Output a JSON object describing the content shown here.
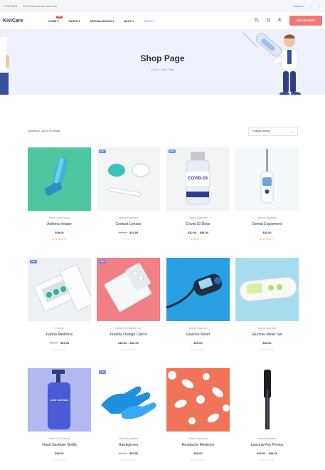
{
  "topbar": {
    "phone": "+1 234 5678",
    "address": "1234 North avenue Lake Lane",
    "follow_label": "Follow us :",
    "social_icons": [
      "facebook-icon",
      "twitter-icon"
    ]
  },
  "navbar": {
    "logo": "KiviCare",
    "items": [
      {
        "label": "HOME",
        "badge": "HOT",
        "active": false
      },
      {
        "label": "PAGES",
        "active": false
      },
      {
        "label": "SPECIALIZATION",
        "active": false
      },
      {
        "label": "BLOG",
        "active": false
      },
      {
        "label": "SHOP",
        "active": true
      }
    ],
    "icons": [
      "search-icon",
      "cart-icon",
      "user-icon"
    ],
    "appointment_label": "APPOINTMENT"
  },
  "hero": {
    "title": "Shop Page",
    "breadcrumb_home": "Home",
    "breadcrumb_sep": "»",
    "breadcrumb_current": "Shop Page"
  },
  "shop": {
    "results_text": "Showing 1–16 of 16 results",
    "sort_label": "Default sorting",
    "products": [
      {
        "category": "Health Care/Physical",
        "name": "Asthma Inhaler",
        "old_price": "",
        "price": "$45.00",
        "rating": 5,
        "sale": false
      },
      {
        "category": "Medical Equipment",
        "name": "Contact Lenses",
        "old_price": "$22.00",
        "price": "$19.00",
        "rating": 0,
        "sale": true
      },
      {
        "category": "Medical Equipment",
        "name": "Covid-19 Dose",
        "old_price": "",
        "price": "$32.00 – $49.00",
        "rating": 3,
        "sale": true
      },
      {
        "category": "Medical Equipment",
        "name": "Dental Equipment",
        "old_price": "",
        "price": "$32.00",
        "rating": 4,
        "sale": false
      },
      {
        "category": "Physical",
        "name": "Farma Medicine",
        "old_price": "$72.00",
        "price": "$69.00",
        "rating": 0,
        "sale": true
      },
      {
        "category": "Health Care/Medical Care",
        "name": "Freshly Orange Carrot",
        "old_price": "",
        "price": "$18.00 – $36.00",
        "rating": 0,
        "sale": true
      },
      {
        "category": "Medical Equipment",
        "name": "Glucose Meter",
        "old_price": "",
        "price": "$20.00",
        "rating": 0,
        "sale": false
      },
      {
        "category": "Medical Equipment",
        "name": "Glucose Meter Set",
        "old_price": "",
        "price": "$35.00",
        "rating": 0,
        "sale": false
      },
      {
        "category": "Health Care/Physical",
        "name": "Hand Sanitizer Bottle",
        "old_price": "",
        "price": "$90.00",
        "rating": 0,
        "sale": false
      },
      {
        "category": "Medical Equipment",
        "name": "Handgloves",
        "old_price": "$65.00",
        "price": "$55.00",
        "rating": 0,
        "sale": true
      },
      {
        "category": "Medical Equipment",
        "name": "Headache Medicine",
        "old_price": "",
        "price": "$46.00",
        "rating": 0,
        "sale": false
      },
      {
        "category": "Medical Equipment",
        "name": "Lancing Pen Pevice",
        "old_price": "",
        "price": "$15.00 – $38.00",
        "rating": 0,
        "sale": false
      }
    ],
    "sale_label": "Sale!",
    "bottle_label": "HAND SANITIZER"
  },
  "colors": {
    "accent": "#8aa0f5",
    "appointment": "#f27878",
    "hero_bg": "#eef1fb",
    "star": "#f5a623"
  }
}
